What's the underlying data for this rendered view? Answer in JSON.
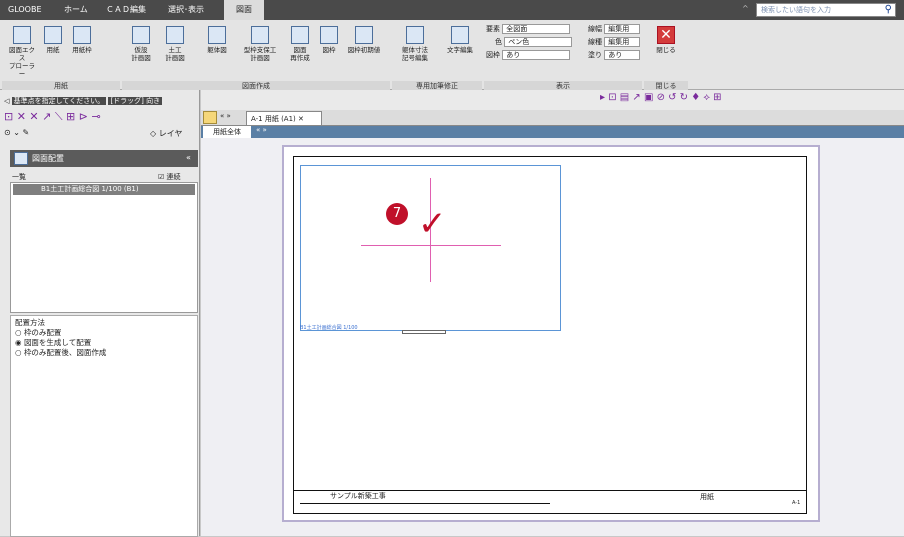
{
  "app": {
    "name": "GLOOBE"
  },
  "tabs": [
    "ホーム",
    "ＣＡＤ編集",
    "選択･表示",
    "図面"
  ],
  "active_tab": "図面",
  "search": {
    "placeholder": "検索したい語句を入力"
  },
  "ribbon": {
    "groups": [
      "用紙",
      "図面作成",
      "専用加筆修正",
      "表示",
      "閉じる"
    ],
    "buttons": [
      {
        "label": "図面エクス",
        "sub": "プローラー"
      },
      {
        "label": "用紙",
        "sub": ""
      },
      {
        "label": "用紙枠",
        "sub": ""
      },
      {
        "label": "仮設",
        "sub": "計画図"
      },
      {
        "label": "土工",
        "sub": "計画図"
      },
      {
        "label": "躯体図",
        "sub": ""
      },
      {
        "label": "型枠支保工",
        "sub": "計画図"
      },
      {
        "label": "図面",
        "sub": "再作成"
      },
      {
        "label": "図枠",
        "sub": ""
      },
      {
        "label": "図枠初期値",
        "sub": ""
      },
      {
        "label": "躯体寸法",
        "sub": "記号編集"
      },
      {
        "label": "文字編集",
        "sub": ""
      },
      {
        "label": "閉じる",
        "sub": ""
      }
    ],
    "display": {
      "element_label": "要素",
      "element_value": "全図面",
      "color_label": "色",
      "color_value": "ペン色",
      "frame_label": "図枠",
      "frame_value": "あり",
      "linewidth_label": "線幅",
      "linewidth_value": "編集用",
      "linetype_label": "線種",
      "linetype_value": "編集用",
      "fill_label": "塗り",
      "fill_value": "あり"
    }
  },
  "prompt": {
    "instruction": "基準点を指定してください。",
    "drag": "[ドラッグ] 向き"
  },
  "panel": {
    "title": "図面配置",
    "list_header": "一覧",
    "continuous_label": "連続",
    "list_items": [
      "B1土工計画総合図 1/100 (B1)"
    ],
    "method_title": "配置方法",
    "options": [
      "枠のみ配置",
      "図面を生成して配置",
      "枠のみ配置後、図面作成"
    ],
    "selected_option": 1,
    "layer_label": "レイヤ"
  },
  "document": {
    "tab_label": "A-1 用紙",
    "tab_sub": "(A1)",
    "sheet_tab": "用紙全体"
  },
  "drawing": {
    "view_caption": "B1土工計画総合図 1/100",
    "project_name": "サンプル新築工事",
    "sheet_name": "用紙",
    "sheet_no": "A-1",
    "step_number": "7"
  }
}
